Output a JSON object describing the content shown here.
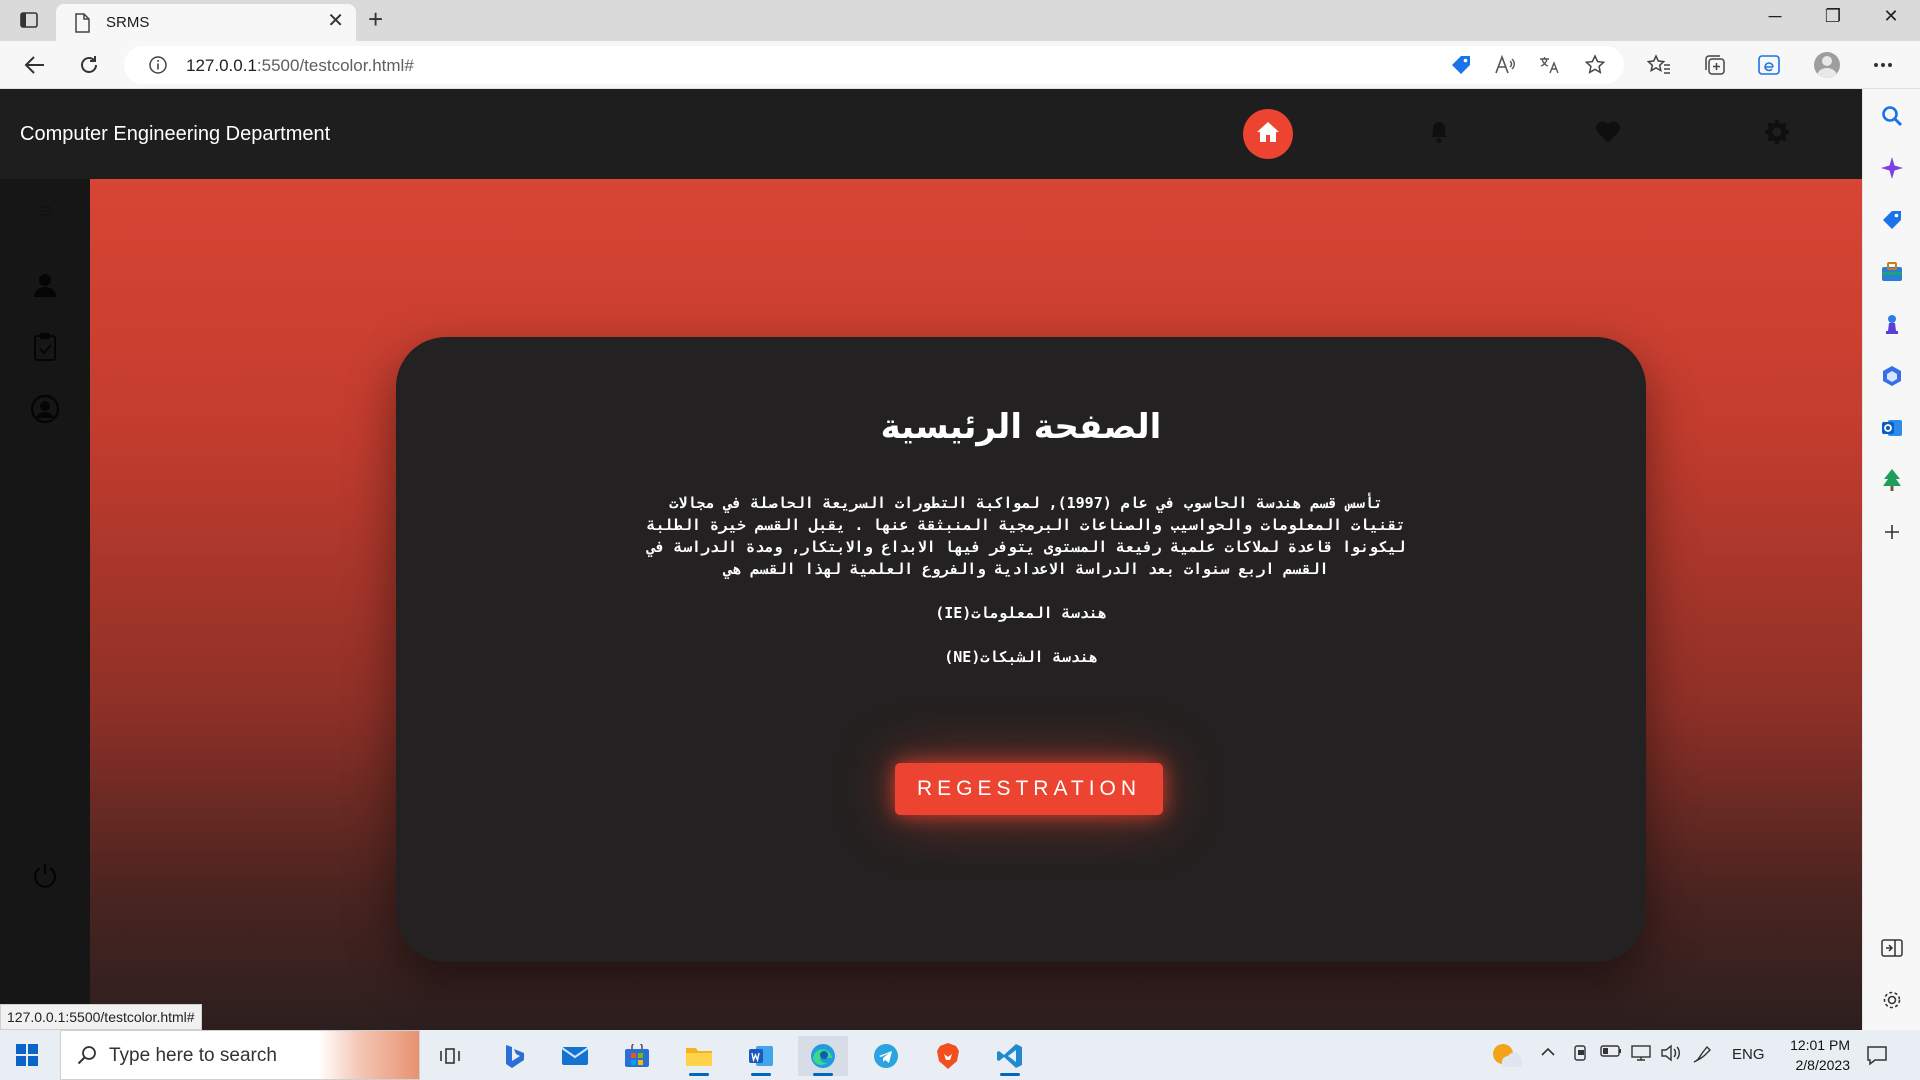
{
  "browser": {
    "tab_title": "SRMS",
    "tab_close": "✕",
    "new_tab": "+",
    "url_host": "127.0.0.1",
    "url_path": ":5500/testcolor.html#",
    "status_url": "127.0.0.1:5500/testcolor.html#",
    "window": {
      "minimize": "─",
      "restore": "❐",
      "close": "✕"
    }
  },
  "header": {
    "title": "Computer Engineering Department",
    "nav_icons": [
      "home-icon",
      "bell-icon",
      "heart-icon",
      "gear-icon"
    ],
    "accent": "#ec4431"
  },
  "sidebar": {
    "icons": [
      "menu-icon",
      "user-icon",
      "clipboard-check-icon",
      "user-circle-icon",
      "power-icon"
    ]
  },
  "card": {
    "title": "الصفحة الرئيسية",
    "body": "تأسس قسم هندسة الحاسوب في عام (1997), لمواكبة التطورات السريعة الحاصلة في مجالات تقنيات المعلومات والحواسيب والصناعات البرمجية المنبثقة عنها . يقبل القسم خيرة الطلبة ليكونوا قاعدة لملاكات علمية رفيعة المستوى يتوفر فيها الابداع والابتكار, ومدة الدراسة في القسم اربع سنوات بعد الدراسة الاعدادية والفروع العلمية لهذا القسم هي",
    "branch1": "هندسة المعلومات(IE)",
    "branch2": "هندسة الشبكات(NE)",
    "button": "REGESTRATION"
  },
  "taskbar": {
    "search_placeholder": "Type here to search",
    "language": "ENG",
    "time": "12:01 PM",
    "date": "2/8/2023"
  }
}
